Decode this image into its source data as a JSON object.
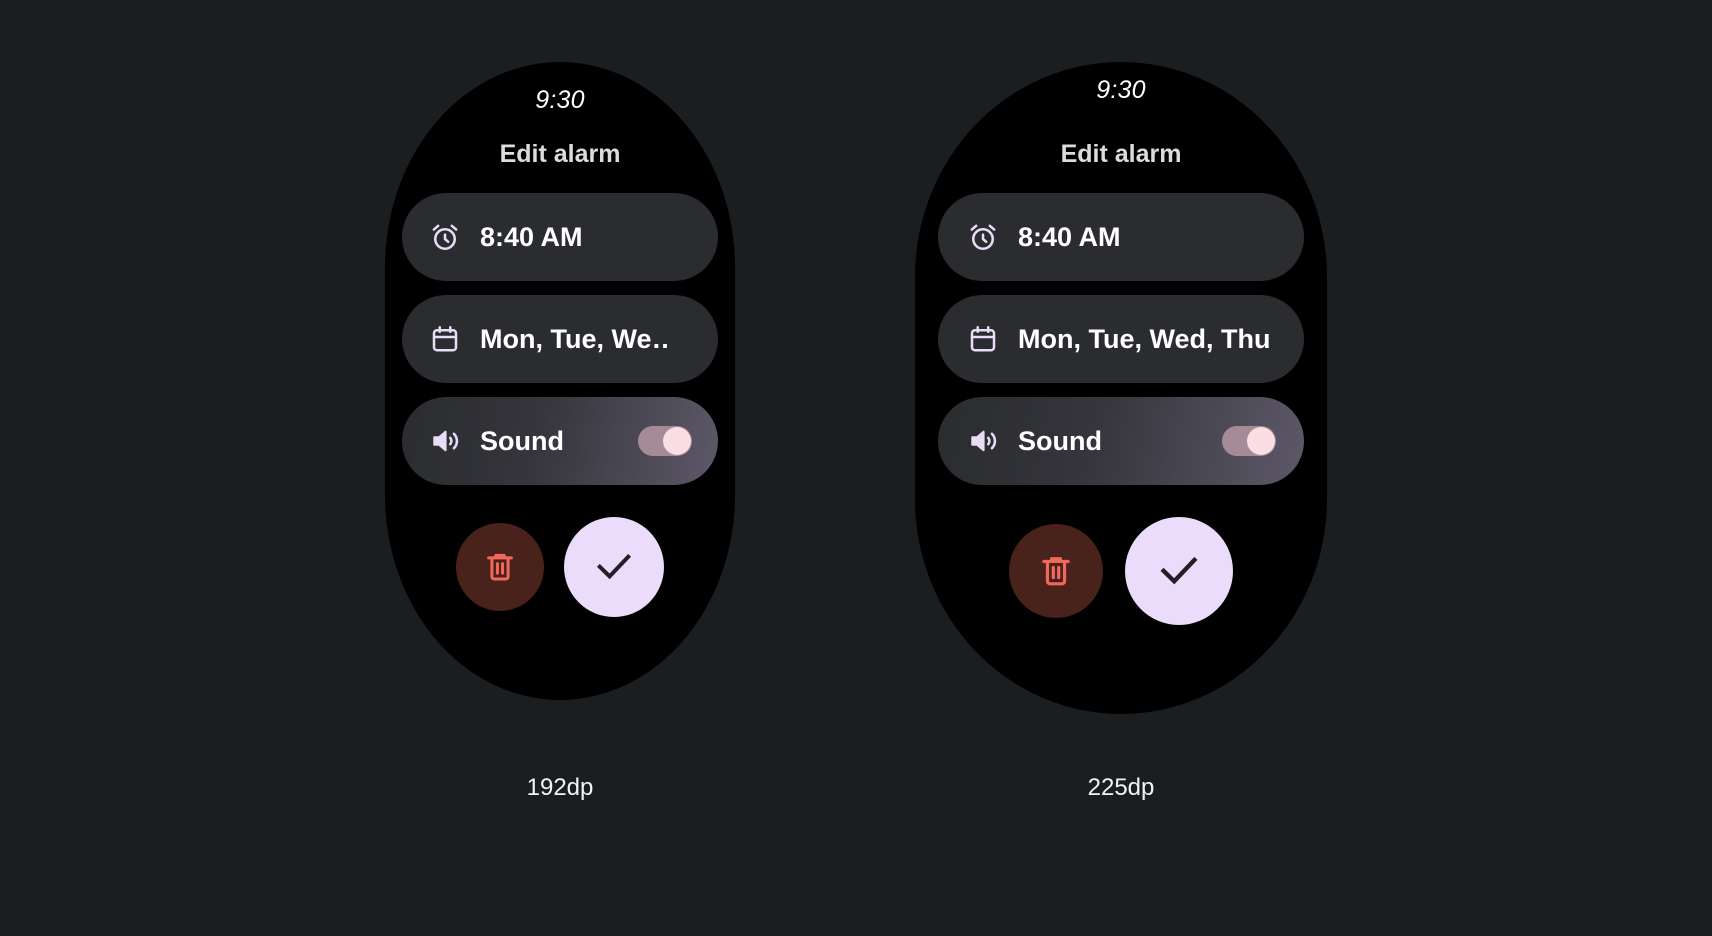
{
  "background_color": "#1a1e21",
  "accent_colors": {
    "icon_lavender": "#e9dcf7",
    "confirm_button_bg": "#ecdcfb",
    "delete_button_bg": "#4a221c",
    "delete_icon": "#f2685c",
    "toggle_track": "#a58b96",
    "toggle_knob": "#fbdee4",
    "row_bg": "#2a2c2f",
    "screen_bg": "#000000"
  },
  "devices": [
    {
      "id": "watch-192dp",
      "size_label": "192dp",
      "status_time": "9:30",
      "screen_title": "Edit alarm",
      "rows": [
        {
          "id": "alarm-time",
          "icon": "alarm-clock-icon",
          "label": "8:40 AM",
          "has_toggle": false
        },
        {
          "id": "repeat-days",
          "icon": "calendar-icon",
          "label": "Mon, Tue, We…",
          "has_toggle": false
        },
        {
          "id": "sound",
          "icon": "volume-up-icon",
          "label": "Sound",
          "has_toggle": true,
          "toggle_on": true
        }
      ],
      "actions": {
        "delete_label": "Delete alarm",
        "delete_icon": "trash-icon",
        "confirm_label": "Confirm alarm",
        "confirm_icon": "check-icon"
      }
    },
    {
      "id": "watch-225dp",
      "size_label": "225dp",
      "status_time": "9:30",
      "screen_title": "Edit alarm",
      "rows": [
        {
          "id": "alarm-time",
          "icon": "alarm-clock-icon",
          "label": "8:40 AM",
          "has_toggle": false
        },
        {
          "id": "repeat-days",
          "icon": "calendar-icon",
          "label": "Mon, Tue, Wed, Thu",
          "has_toggle": false
        },
        {
          "id": "sound",
          "icon": "volume-up-icon",
          "label": "Sound",
          "has_toggle": true,
          "toggle_on": true
        }
      ],
      "actions": {
        "delete_label": "Delete alarm",
        "delete_icon": "trash-icon",
        "confirm_label": "Confirm alarm",
        "confirm_icon": "check-icon"
      }
    }
  ]
}
